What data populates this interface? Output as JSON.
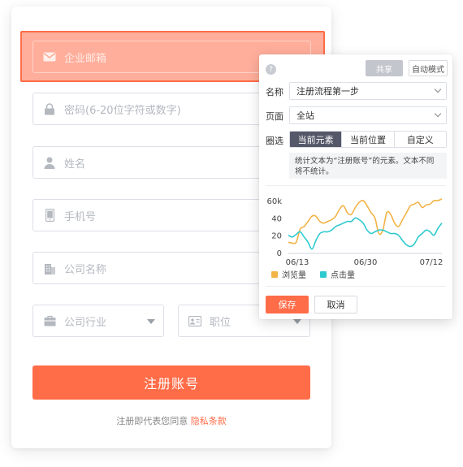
{
  "form": {
    "email_placeholder": "企业邮箱",
    "password_placeholder": "密码(6-20位字符或数字)",
    "name_placeholder": "姓名",
    "phone_placeholder": "手机号",
    "company_placeholder": "公司名称",
    "industry_placeholder": "公司行业",
    "position_placeholder": "职位",
    "register_label": "注册账号",
    "agree_prefix": "注册即代表您同意",
    "privacy_link": "隐私条款"
  },
  "panel": {
    "help_label": "?",
    "share_label": "共享",
    "auto_mode_label": "自动模式",
    "name_label": "名称",
    "name_value": "注册流程第一步",
    "page_label": "页面",
    "page_value": "全站",
    "circle_label": "圈选",
    "circle_options": [
      "当前元素",
      "当前位置",
      "自定义"
    ],
    "circle_selected": "当前元素",
    "note": "统计文本为“注册账号”的元素。文本不同将不统计。",
    "save_label": "保存",
    "cancel_label": "取消"
  },
  "chart_data": {
    "type": "line",
    "yticks": [
      "60k",
      "40",
      "20",
      "0"
    ],
    "ylim": [
      0,
      60
    ],
    "xticks": [
      "06/13",
      "06/30",
      "07/12"
    ],
    "series": [
      {
        "name": "浏览量",
        "color": "#f2b347",
        "values": [
          12,
          11,
          12,
          27,
          30,
          36,
          42,
          42,
          36,
          34,
          36,
          38,
          42,
          50,
          54,
          46,
          44,
          52,
          58,
          60,
          54,
          46,
          40,
          22,
          26,
          46,
          44,
          34,
          30,
          38,
          46,
          54,
          56,
          58,
          52,
          55,
          56,
          60,
          60,
          62
        ]
      },
      {
        "name": "点击量",
        "color": "#2ecad0",
        "values": [
          20,
          18,
          21,
          24,
          18,
          12,
          4,
          14,
          22,
          24,
          24,
          26,
          30,
          32,
          34,
          36,
          36,
          40,
          38,
          34,
          26,
          22,
          24,
          26,
          26,
          24,
          22,
          22,
          20,
          14,
          9,
          7,
          10,
          18,
          22,
          26,
          24,
          20,
          28,
          34
        ]
      }
    ],
    "grid": false,
    "legend": "bottom-left"
  },
  "colors": {
    "accent": "#ff6c48",
    "segment_active": "#545869"
  },
  "icons": {
    "email": "envelope-icon",
    "password": "lock-icon",
    "name": "user-icon",
    "phone": "phone-icon",
    "company": "building-icon",
    "industry": "briefcase-icon",
    "position": "id-card-icon"
  }
}
